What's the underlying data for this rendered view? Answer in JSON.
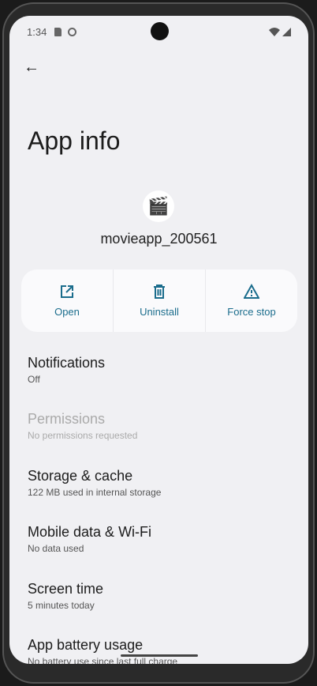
{
  "status": {
    "time": "1:34",
    "icons": [
      "sd-card-icon",
      "face-icon",
      "wifi-icon",
      "signal-icon"
    ]
  },
  "header": {
    "title": "App info",
    "back_icon": "arrow-left-icon"
  },
  "app": {
    "name": "movieapp_200561",
    "icon": "clapperboard-icon"
  },
  "actions": [
    {
      "label": "Open",
      "icon": "open-external-icon"
    },
    {
      "label": "Uninstall",
      "icon": "trash-icon"
    },
    {
      "label": "Force stop",
      "icon": "warning-icon"
    }
  ],
  "items": [
    {
      "label": "Notifications",
      "sub": "Off",
      "enabled": true
    },
    {
      "label": "Permissions",
      "sub": "No permissions requested",
      "enabled": false
    },
    {
      "label": "Storage & cache",
      "sub": "122 MB used in internal storage",
      "enabled": true
    },
    {
      "label": "Mobile data & Wi-Fi",
      "sub": "No data used",
      "enabled": true
    },
    {
      "label": "Screen time",
      "sub": "5 minutes today",
      "enabled": true
    },
    {
      "label": "App battery usage",
      "sub": "No battery use since last full charge",
      "enabled": true
    }
  ],
  "colors": {
    "accent": "#1a6c8c",
    "background": "#f0f0f3"
  }
}
